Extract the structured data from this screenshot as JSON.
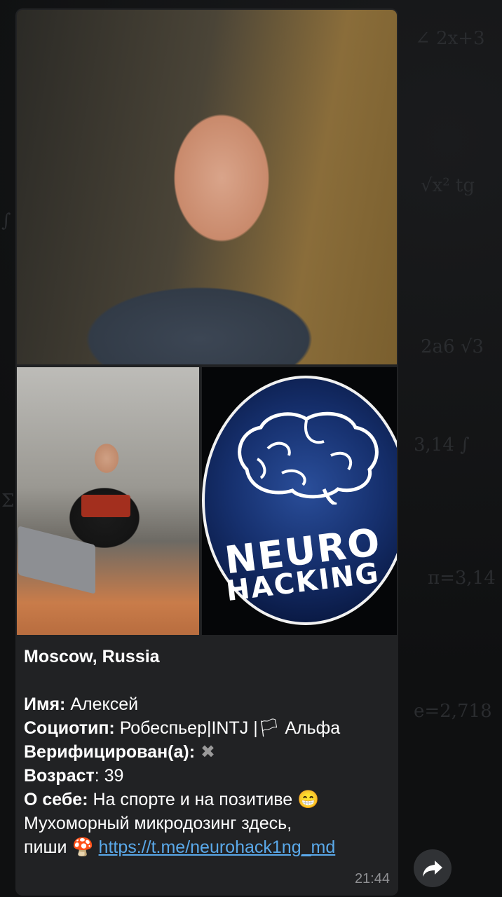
{
  "message": {
    "location": "Moscow, Russia",
    "fields": [
      {
        "label": "Имя:",
        "value": " Алексей"
      },
      {
        "label": "Социотип:",
        "value": " Робеспьер|INTJ |🏳 Альфа"
      },
      {
        "label": "Верифицирован(а):",
        "value": ""
      },
      {
        "label": "Возраст",
        "value": ": 39"
      },
      {
        "label": "О себе:",
        "value": " На спорте и на позитиве 😁"
      }
    ],
    "about_line2": "Мухоморный микродозинг здесь,",
    "about_line3_prefix": "пиши 🍄 ",
    "link": "https://t.me/neurohack1ng_md",
    "verified_mark": "✖",
    "time": "21:44"
  },
  "logo": {
    "line1": "NEURO",
    "line2": "HACKING"
  },
  "icons": {
    "share": "share-arrow-icon",
    "brain": "brain-icon"
  },
  "colors": {
    "bubble": "#212224",
    "link": "#5aa9ea",
    "background": "#0f1011"
  }
}
